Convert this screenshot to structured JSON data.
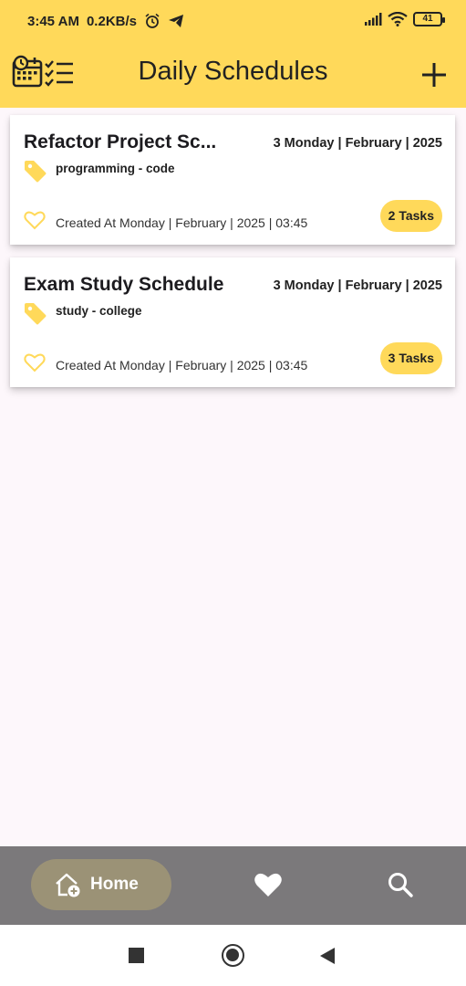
{
  "status_bar": {
    "time": "3:45 AM",
    "net_speed": "0.2KB/s",
    "battery": "41",
    "icons": [
      "alarm-icon",
      "telegram-icon",
      "signal-icon",
      "wifi-icon",
      "battery-icon"
    ]
  },
  "app_bar": {
    "title": "Daily Schedules",
    "logo_icon": "calendar-checklist-icon",
    "add_icon": "plus-icon",
    "background": "#ffd95a"
  },
  "schedules": [
    {
      "title": "Refactor Project Sc...",
      "date": "3 Monday | February | 2025",
      "tags": "programming - code",
      "created": "Created At Monday | February | 2025 | 03:45",
      "tasks": "2 Tasks"
    },
    {
      "title": "Exam Study Schedule",
      "date": "3 Monday | February | 2025",
      "tags": "study - college",
      "created": "Created At Monday | February | 2025 | 03:45",
      "tasks": "3 Tasks"
    }
  ],
  "bottom_nav": {
    "items": [
      {
        "label": "Home",
        "icon": "home-add-icon",
        "active": true
      },
      {
        "label": "",
        "icon": "heart-icon",
        "active": false
      },
      {
        "label": "",
        "icon": "search-icon",
        "active": false
      }
    ],
    "background": "#7b797b",
    "active_pill": "#9b9276"
  },
  "system_nav": {
    "icons": [
      "recent-apps-icon",
      "home-circle-icon",
      "back-icon"
    ]
  },
  "colors": {
    "accent": "#ffd95a",
    "background": "#fdf7fb",
    "card": "#ffffff"
  }
}
